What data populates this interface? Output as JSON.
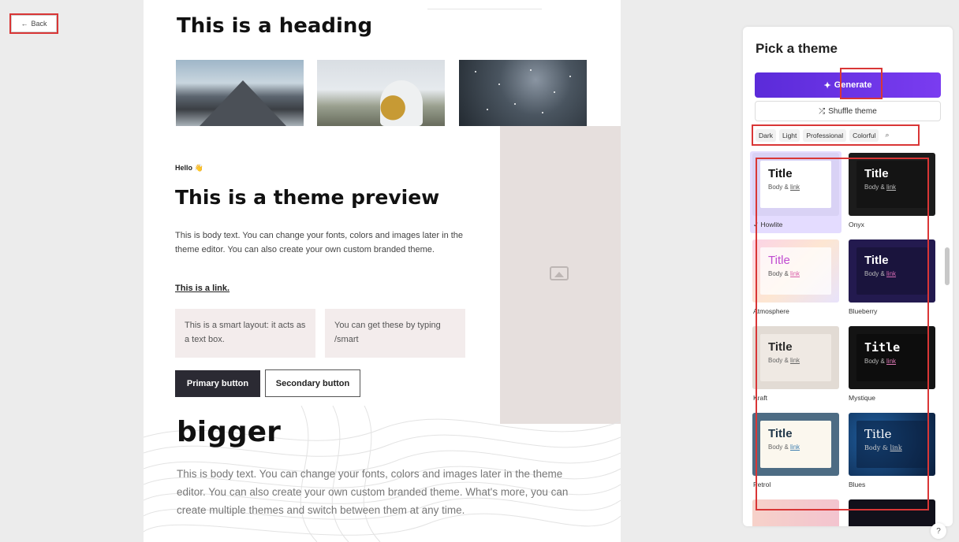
{
  "back_button": {
    "label": "Back",
    "icon": "arrow-left-icon"
  },
  "preview": {
    "heading": "This is a heading",
    "hello": "Hello",
    "hello_emoji": "👋",
    "theme_preview_heading": "This is a theme preview",
    "body_text": "This is body text. You can change your fonts, colors and images later in the theme editor. You can also create your own custom branded theme.",
    "link_text": "This is a link.",
    "smart_layout_1": "This is a smart layout: it acts as a text box.",
    "smart_layout_2": "You can get these by typing /smart",
    "primary_button": "Primary button",
    "secondary_button": "Secondary button",
    "bigger_heading": "bigger",
    "body_text_2": "This is body text. You can change your fonts, colors and images later in the theme editor. You can also create your own custom branded theme. What's more, you can create multiple themes and switch between them at any time."
  },
  "sidebar": {
    "title": "Pick a theme",
    "generate_label": "Generate",
    "shuffle_label": "Shuffle theme",
    "filters": [
      "Dark",
      "Light",
      "Professional",
      "Colorful"
    ],
    "themes": [
      {
        "name": "Howlite",
        "title": "Title",
        "body": "Body &",
        "link": "link",
        "selected": true
      },
      {
        "name": "Onyx",
        "title": "Title",
        "body": "Body &",
        "link": "link"
      },
      {
        "name": "Atmosphere",
        "title": "Title",
        "body": "Body &",
        "link": "link"
      },
      {
        "name": "Blueberry",
        "title": "Title",
        "body": "Body &",
        "link": "link"
      },
      {
        "name": "Kraft",
        "title": "Title",
        "body": "Body &",
        "link": "link"
      },
      {
        "name": "Mystique",
        "title": "Title",
        "body": "Body &",
        "link": "link"
      },
      {
        "name": "Petrol",
        "title": "Title",
        "body": "Body &",
        "link": "link"
      },
      {
        "name": "Blues",
        "title": "Title",
        "body": "Body &",
        "link": "link"
      }
    ]
  },
  "help_label": "?",
  "colors": {
    "accent": "#6b34e8",
    "annotation": "#d93636"
  }
}
